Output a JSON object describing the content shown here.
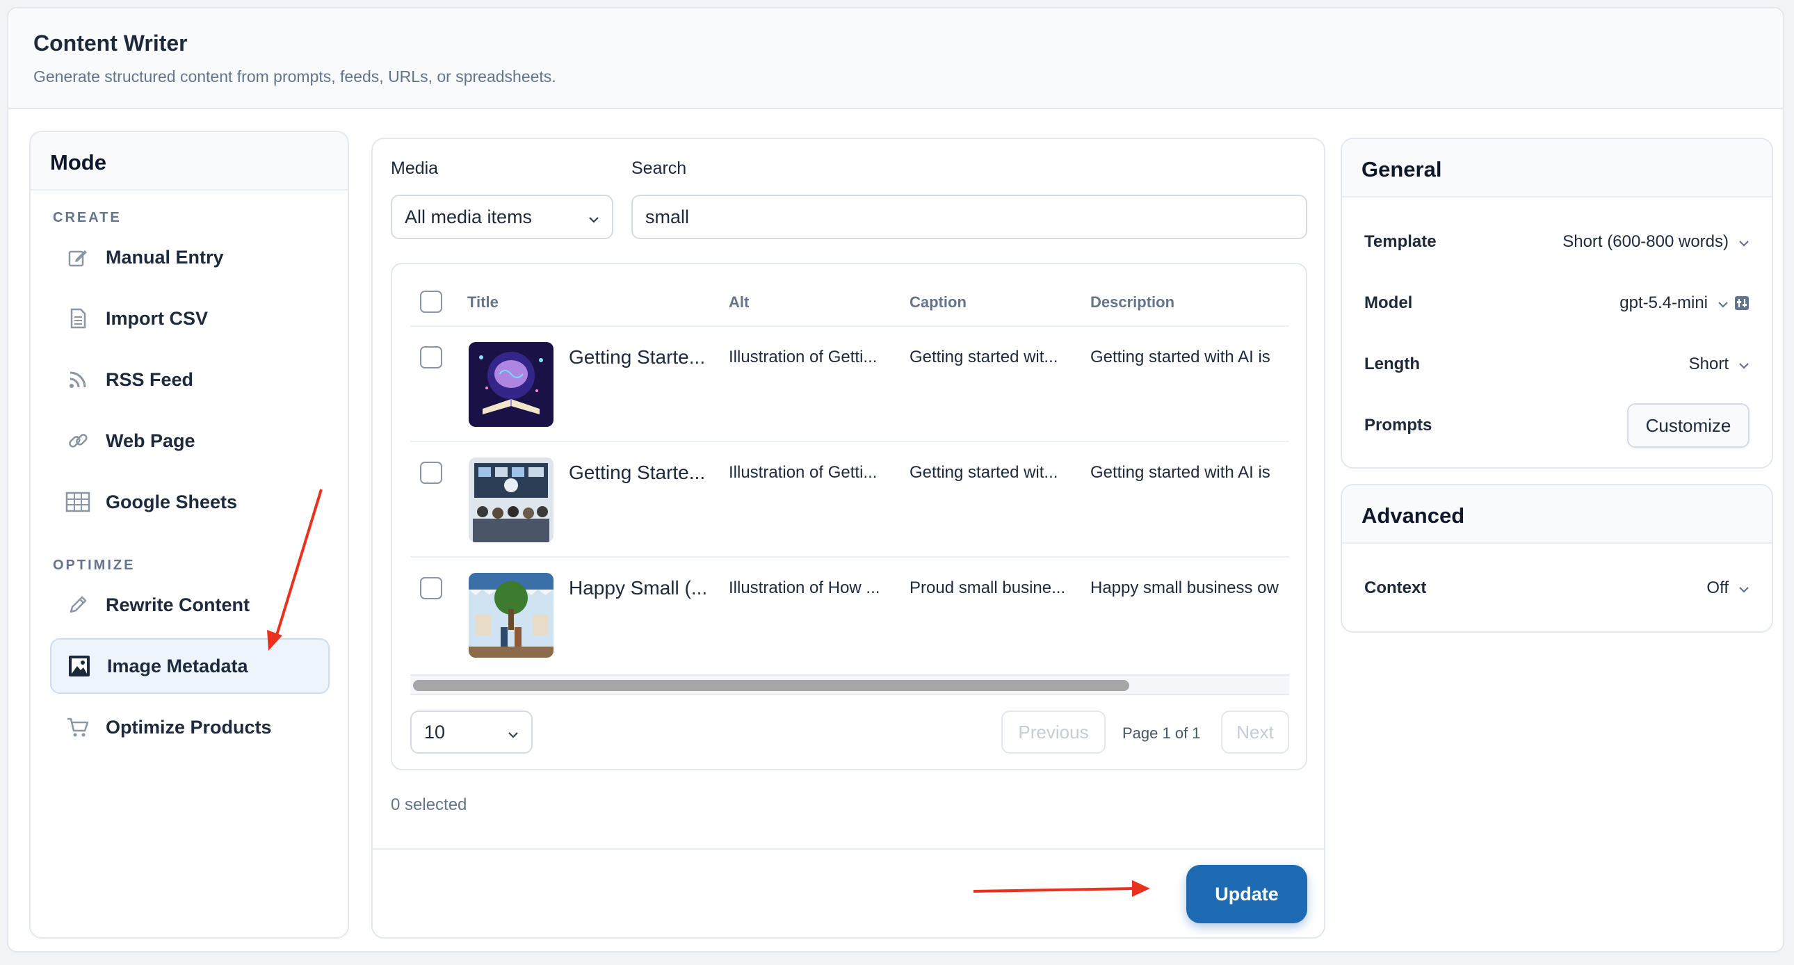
{
  "header": {
    "title": "Content Writer",
    "subtitle": "Generate structured content from prompts, feeds, URLs, or spreadsheets."
  },
  "sidebar": {
    "title": "Mode",
    "sections": [
      {
        "label": "CREATE",
        "items": [
          {
            "label": "Manual Entry",
            "icon": "edit-icon"
          },
          {
            "label": "Import CSV",
            "icon": "document-icon"
          },
          {
            "label": "RSS Feed",
            "icon": "rss-icon"
          },
          {
            "label": "Web Page",
            "icon": "link-icon"
          },
          {
            "label": "Google Sheets",
            "icon": "table-icon"
          }
        ]
      },
      {
        "label": "OPTIMIZE",
        "items": [
          {
            "label": "Rewrite Content",
            "icon": "pencil-icon"
          },
          {
            "label": "Image Metadata",
            "icon": "image-icon",
            "active": true
          },
          {
            "label": "Optimize Products",
            "icon": "cart-icon"
          }
        ]
      }
    ]
  },
  "media": {
    "label": "Media",
    "selected": "All media items",
    "search_label": "Search",
    "search_value": "small"
  },
  "table": {
    "columns": [
      "Title",
      "Alt",
      "Caption",
      "Description"
    ],
    "rows": [
      {
        "title": "Getting Starte...",
        "alt": "Illustration of Getti...",
        "caption": "Getting started wit...",
        "description": "Getting started with AI is"
      },
      {
        "title": "Getting Starte...",
        "alt": "Illustration of Getti...",
        "caption": "Getting started wit...",
        "description": "Getting started with AI is"
      },
      {
        "title": "Happy Small (...",
        "alt": "Illustration of How ...",
        "caption": "Proud small busine...",
        "description": "Happy small business ow"
      }
    ],
    "per_page": "10",
    "previous_label": "Previous",
    "page_info": "Page 1 of 1",
    "next_label": "Next",
    "selected_count": "0 selected",
    "scroll_position": 0.82
  },
  "update_label": "Update",
  "general": {
    "title": "General",
    "template_label": "Template",
    "template_value": "Short (600-800 words)",
    "model_label": "Model",
    "model_value": "gpt-5.4-mini",
    "length_label": "Length",
    "length_value": "Short",
    "prompts_label": "Prompts",
    "customize_label": "Customize"
  },
  "advanced": {
    "title": "Advanced",
    "context_label": "Context",
    "context_value": "Off"
  },
  "colors": {
    "accent": "#1f6bb3",
    "annotation_arrow": "#e8321e"
  }
}
